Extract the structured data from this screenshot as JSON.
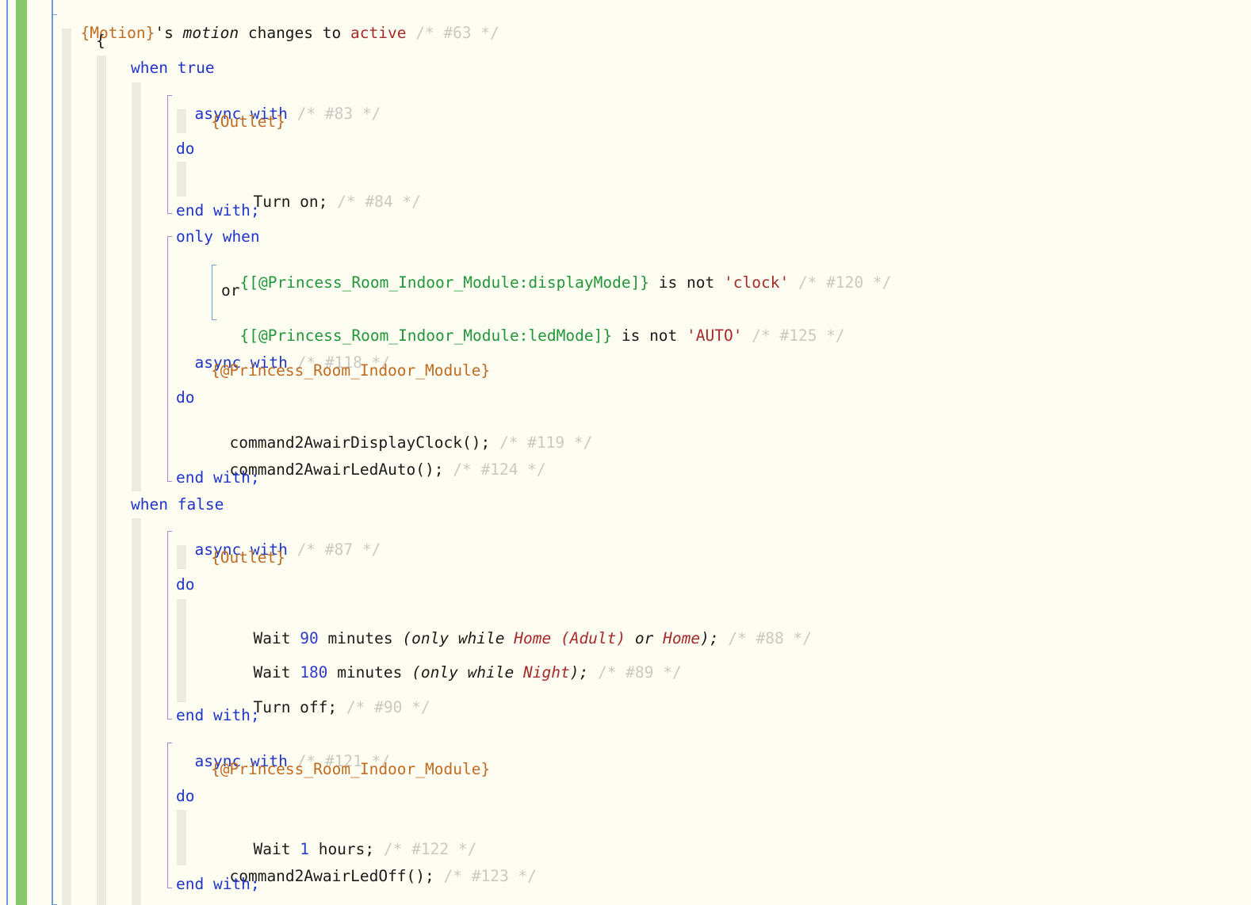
{
  "header": {
    "device": "{Motion}",
    "possessive": "'s",
    "attribute": "motion",
    "changes_to": "changes to",
    "value": "active",
    "comment": "/* #63 */"
  },
  "open_brace": "{",
  "when_true": "when true",
  "async1": {
    "kw": "async with",
    "comment": "/* #83 */",
    "device": "{Outlet}",
    "do": "do",
    "end": "end with;"
  },
  "turn_on": {
    "text": "Turn on;",
    "comment": "/* #84 */"
  },
  "only_when": "only when",
  "cond1": {
    "var": "{[@Princess_Room_Indoor_Module:displayMode]}",
    "op": "is not",
    "str": "'clock'",
    "comment": "/* #120 */"
  },
  "cond_or": "or",
  "cond2": {
    "var": "{[@Princess_Room_Indoor_Module:ledMode]}",
    "op": "is not",
    "str": "'AUTO'",
    "comment": "/* #125 */"
  },
  "async2": {
    "kw": "async with",
    "comment": "/* #118 */",
    "device": "{@Princess_Room_Indoor_Module}",
    "do": "do",
    "end": "end with;"
  },
  "cmd_clock": {
    "text": "command2AwairDisplayClock();",
    "comment": "/* #119 */"
  },
  "cmd_auto": {
    "text": "command2AwairLedAuto();",
    "comment": "/* #124 */"
  },
  "when_false": "when false",
  "async3": {
    "kw": "async with",
    "comment": "/* #87 */",
    "device": "{Outlet}",
    "do": "do",
    "end": "end with;"
  },
  "wait90": {
    "wait": "Wait",
    "num": "90",
    "unit": "minutes",
    "only_while": "(only while",
    "loc1": "Home (Adult)",
    "or": "or",
    "loc2": "Home",
    "close": ");",
    "comment": "/* #88 */"
  },
  "wait180": {
    "wait": "Wait",
    "num": "180",
    "unit": "minutes",
    "only_while": "(only while",
    "loc1": "Night",
    "close": ");",
    "comment": "/* #89 */"
  },
  "turn_off": {
    "text": "Turn off;",
    "comment": "/* #90 */"
  },
  "async4": {
    "kw": "async with",
    "comment": "/* #121 */",
    "device": "{@Princess_Room_Indoor_Module}",
    "do": "do",
    "end": "end with;"
  },
  "wait1h": {
    "wait": "Wait",
    "num": "1",
    "unit": "hours;",
    "comment": "/* #122 */"
  },
  "cmd_off": {
    "text": "command2AwairLedOff();",
    "comment": "/* #123 */"
  }
}
